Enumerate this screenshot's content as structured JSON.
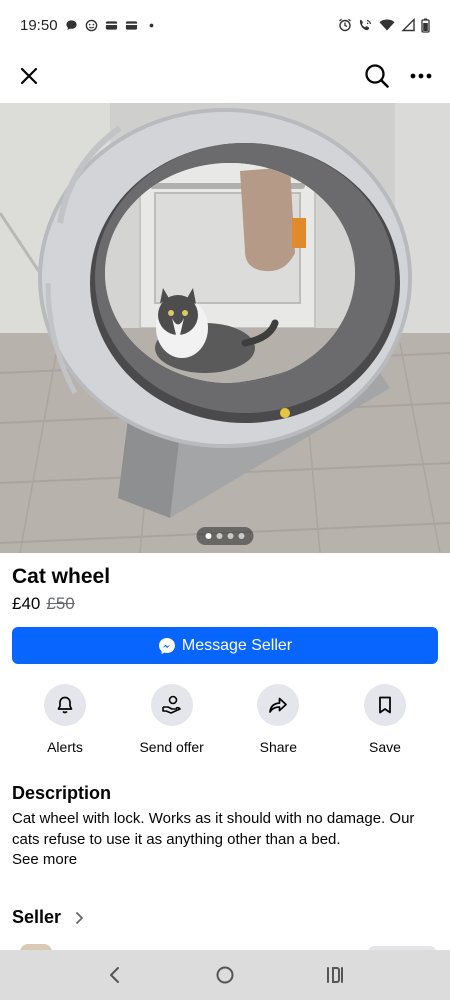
{
  "status_bar": {
    "time": "19:50",
    "icons": [
      "chat-bubble-icon",
      "face-icon",
      "card-icon",
      "card-icon",
      "dot-icon",
      "alarm-icon",
      "wifi-calling-icon",
      "wifi-icon",
      "signal-icon",
      "battery-icon"
    ]
  },
  "top_nav": {
    "close_icon": "close-icon",
    "search_icon": "search-icon",
    "more_icon": "more-icon"
  },
  "gallery": {
    "image_count": 4,
    "active_index": 0
  },
  "listing": {
    "title": "Cat wheel",
    "price": "£40",
    "original_price": "£50"
  },
  "message_button": {
    "label": "Message Seller",
    "color": "#0866ff"
  },
  "actions": [
    {
      "label": "Alerts",
      "icon": "bell-icon"
    },
    {
      "label": "Send offer",
      "icon": "send-offer-icon"
    },
    {
      "label": "Share",
      "icon": "share-icon"
    },
    {
      "label": "Save",
      "icon": "bookmark-icon"
    }
  ],
  "description": {
    "heading": "Description",
    "body": "Cat wheel with lock. Works as it should with no damage. Our cats refuse to use it as anything other than a bed.",
    "see_more": "See more"
  },
  "seller": {
    "heading": "Seller"
  },
  "system_nav": [
    "back-icon",
    "home-icon",
    "recents-icon"
  ]
}
